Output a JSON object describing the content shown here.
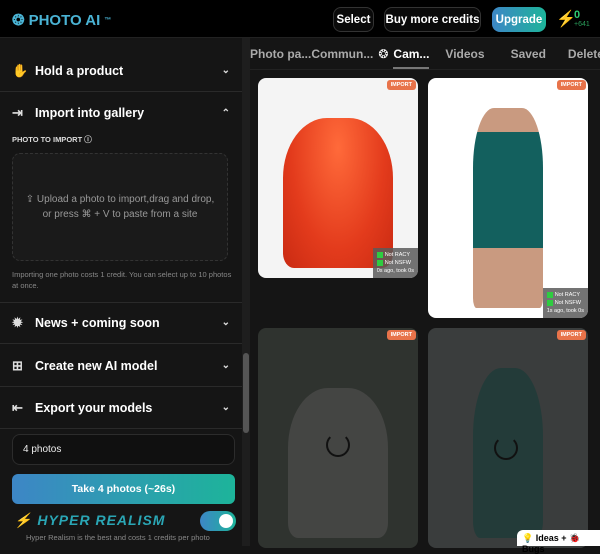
{
  "header": {
    "logo": "PHOTO AI",
    "logo_tm": "™",
    "select": "Select",
    "buy": "Buy more credits",
    "upgrade": "Upgrade",
    "credits": "0",
    "credits_sub": "+641"
  },
  "sidebar": {
    "sections": [
      {
        "label": "Hold a product"
      },
      {
        "label": "Import into gallery"
      },
      {
        "label": "News + coming soon"
      },
      {
        "label": "Create new AI model"
      },
      {
        "label": "Export your models"
      }
    ],
    "photo_to_import": "PHOTO TO IMPORT",
    "dropzone": "Upload a photo to import,drag and drop, or press ⌘ + V to paste from a site",
    "note": "Importing one photo costs 1 credit. You can select up to 10 photos at once.",
    "count_value": "4 photos",
    "take_button": "Take 4 photos (~26s)",
    "hyper_realism": "HYPER REALISM",
    "hyper_realism_enabled": true,
    "hyper_realism_note": "Hyper Realism is the best and costs 1 credits per photo"
  },
  "tabs": [
    {
      "label": "Photo pa..."
    },
    {
      "label": "Commun..."
    },
    {
      "label": "Cam..."
    },
    {
      "label": "Videos"
    },
    {
      "label": "Saved"
    },
    {
      "label": "Deleted"
    }
  ],
  "gallery": {
    "badge": "IMPORT",
    "items": [
      {
        "racy": "Not RACY",
        "nsfw": "Not NSFW",
        "time": "0s ago, took 0s"
      },
      {
        "racy": "Not RACY",
        "nsfw": "Not NSFW",
        "time": "1s ago, took 0s"
      }
    ]
  },
  "feedback": "💡 Ideas + 🐞 Bugs"
}
